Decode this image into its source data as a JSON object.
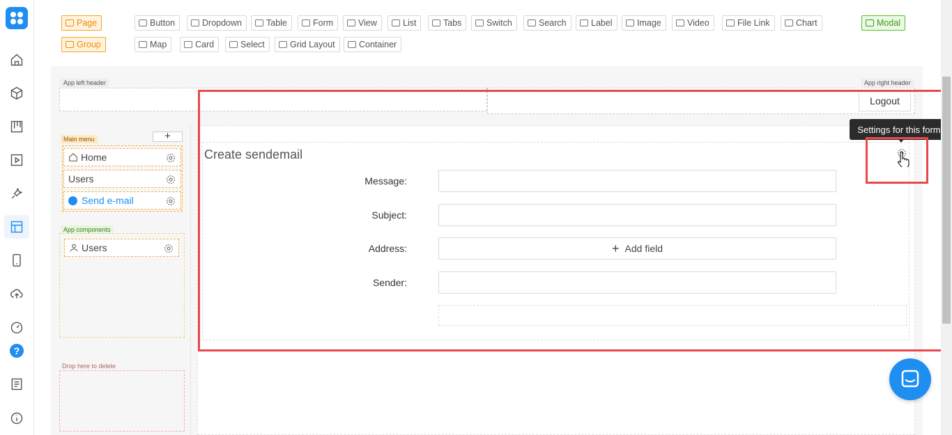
{
  "toolbar": {
    "page": "Page",
    "group": "Group",
    "modal": "Modal",
    "row1": [
      "Button",
      "Dropdown",
      "Table",
      "Form",
      "View",
      "List",
      "Tabs",
      "Switch",
      "Search",
      "Label",
      "Image",
      "Video",
      "File Link",
      "Chart"
    ],
    "row2": [
      "Map",
      "Card",
      "Select",
      "Grid Layout",
      "Container"
    ]
  },
  "header": {
    "left_tag": "App left header",
    "right_tag": "App right header",
    "logout": "Logout"
  },
  "sidebar": {
    "main_menu_tag": "Main menu",
    "add": "+",
    "items": [
      {
        "label": "Home"
      },
      {
        "label": "Users"
      },
      {
        "label": "Send e-mail"
      }
    ],
    "components_tag": "App components",
    "components": [
      {
        "label": "Users"
      }
    ],
    "delete_tag": "Drop here to delete"
  },
  "form": {
    "title": "Create sendemail",
    "fields": [
      {
        "label": "Message:",
        "value": ""
      },
      {
        "label": "Subject:",
        "value": ""
      },
      {
        "label": "Address:",
        "value": "Add field"
      },
      {
        "label": "Sender:",
        "value": ""
      }
    ]
  },
  "tooltip": "Settings for this form",
  "colors": {
    "accent": "#1f8ef1",
    "highlight": "#e8474b",
    "orange": "#f5a623",
    "green": "#52c41a"
  }
}
